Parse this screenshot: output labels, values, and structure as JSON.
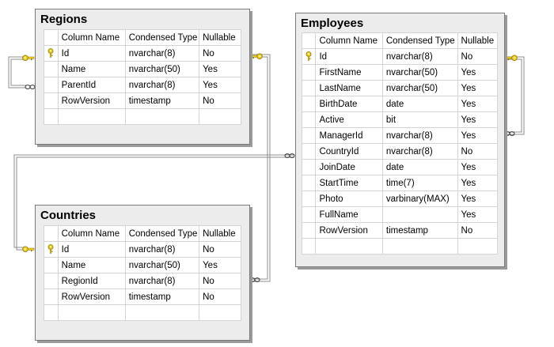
{
  "columns": [
    "Column Name",
    "Condensed Type",
    "Nullable"
  ],
  "tables": {
    "regions": {
      "title": "Regions",
      "rows": [
        {
          "pk": true,
          "name": "Id",
          "type": "nvarchar(8)",
          "nullable": "No"
        },
        {
          "pk": false,
          "name": "Name",
          "type": "nvarchar(50)",
          "nullable": "Yes"
        },
        {
          "pk": false,
          "name": "ParentId",
          "type": "nvarchar(8)",
          "nullable": "Yes"
        },
        {
          "pk": false,
          "name": "RowVersion",
          "type": "timestamp",
          "nullable": "No"
        }
      ]
    },
    "countries": {
      "title": "Countries",
      "rows": [
        {
          "pk": true,
          "name": "Id",
          "type": "nvarchar(8)",
          "nullable": "No"
        },
        {
          "pk": false,
          "name": "Name",
          "type": "nvarchar(50)",
          "nullable": "Yes"
        },
        {
          "pk": false,
          "name": "RegionId",
          "type": "nvarchar(8)",
          "nullable": "No"
        },
        {
          "pk": false,
          "name": "RowVersion",
          "type": "timestamp",
          "nullable": "No"
        }
      ]
    },
    "employees": {
      "title": "Employees",
      "rows": [
        {
          "pk": true,
          "name": "Id",
          "type": "nvarchar(8)",
          "nullable": "No"
        },
        {
          "pk": false,
          "name": "FirstName",
          "type": "nvarchar(50)",
          "nullable": "Yes"
        },
        {
          "pk": false,
          "name": "LastName",
          "type": "nvarchar(50)",
          "nullable": "Yes"
        },
        {
          "pk": false,
          "name": "BirthDate",
          "type": "date",
          "nullable": "Yes"
        },
        {
          "pk": false,
          "name": "Active",
          "type": "bit",
          "nullable": "Yes"
        },
        {
          "pk": false,
          "name": "ManagerId",
          "type": "nvarchar(8)",
          "nullable": "Yes"
        },
        {
          "pk": false,
          "name": "CountryId",
          "type": "nvarchar(8)",
          "nullable": "No"
        },
        {
          "pk": false,
          "name": "JoinDate",
          "type": "date",
          "nullable": "Yes"
        },
        {
          "pk": false,
          "name": "StartTime",
          "type": "time(7)",
          "nullable": "Yes"
        },
        {
          "pk": false,
          "name": "Photo",
          "type": "varbinary(MAX)",
          "nullable": "Yes"
        },
        {
          "pk": false,
          "name": "FullName",
          "type": "",
          "nullable": "Yes"
        },
        {
          "pk": false,
          "name": "RowVersion",
          "type": "timestamp",
          "nullable": "No"
        }
      ]
    }
  },
  "relationships": [
    {
      "name": "regions-parent-self",
      "from": "regions.ParentId",
      "to": "regions.Id"
    },
    {
      "name": "countries-region",
      "from": "countries.RegionId",
      "to": "regions.Id"
    },
    {
      "name": "employees-country",
      "from": "employees.CountryId",
      "to": "countries.Id"
    },
    {
      "name": "employees-manager-self",
      "from": "employees.ManagerId",
      "to": "employees.Id"
    }
  ],
  "colors": {
    "table_bg": "#ececec",
    "border": "#7a7a7a",
    "shadow": "#9a9a9a",
    "connector": "#8c8c8c",
    "key_fill": "#f2d21b",
    "key_stroke": "#8a6f00"
  },
  "icons": {
    "primary_key": "key-icon",
    "one_end": "key-icon",
    "many_end": "infinity-icon"
  }
}
